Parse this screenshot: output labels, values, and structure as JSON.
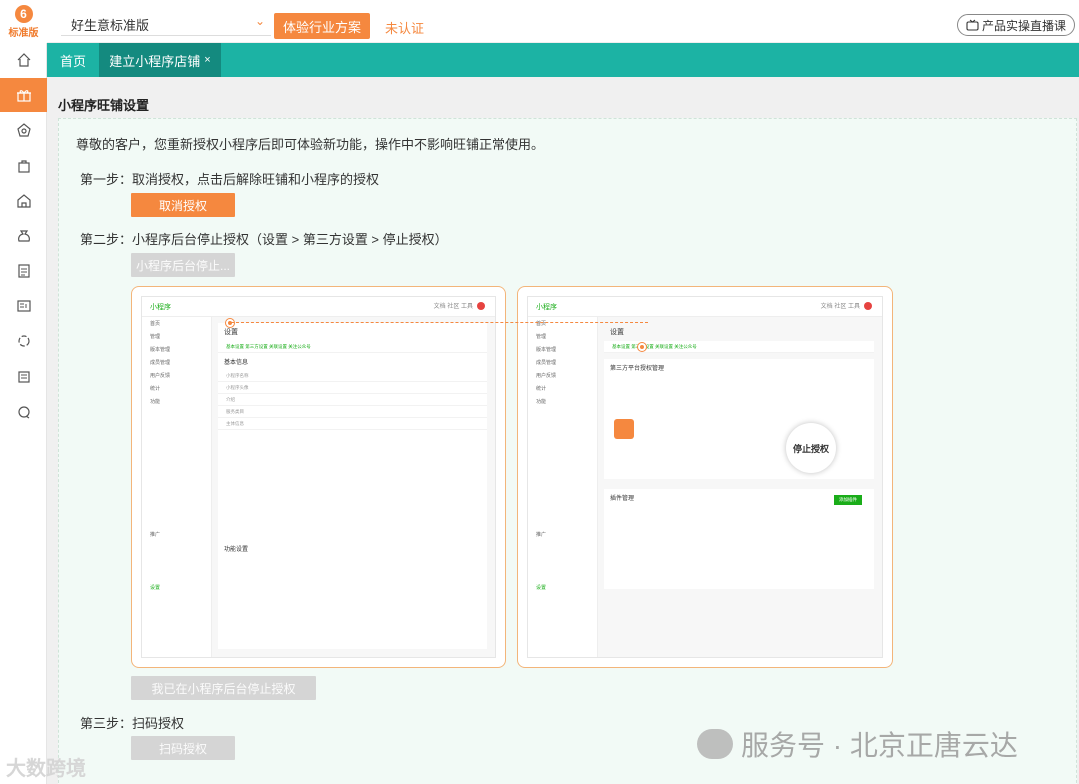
{
  "app": {
    "logo_text": "标准版",
    "store_name": "好生意标准版",
    "solution_button": "体验行业方案",
    "certification_status": "未认证",
    "live_button": "产品实操直播课"
  },
  "sidebar": {
    "items": [
      {
        "icon": "home-icon"
      },
      {
        "icon": "gift-icon"
      },
      {
        "icon": "store-icon"
      },
      {
        "icon": "bag-icon"
      },
      {
        "icon": "shop-icon"
      },
      {
        "icon": "money-bag-icon"
      },
      {
        "icon": "document-icon"
      },
      {
        "icon": "report-icon"
      },
      {
        "icon": "cycle-icon"
      },
      {
        "icon": "news-icon"
      },
      {
        "icon": "chat-icon"
      }
    ],
    "active_index": 1
  },
  "tabs": {
    "home": "首页",
    "active": "建立小程序店铺",
    "close": "×"
  },
  "page": {
    "title": "小程序旺铺设置",
    "notice": "尊敬的客户，您重新授权小程序后即可体验新功能，操作中不影响旺铺正常使用。",
    "step1": "第一步：取消授权，点击后解除旺铺和小程序的授权",
    "step1_button": "取消授权",
    "step2": "第二步：小程序后台停止授权（设置 > 第三方设置 > 停止授权）",
    "step2_button": "小程序后台停止...",
    "confirm_button": "我已在小程序后台停止授权",
    "step3": "第三步：扫码授权",
    "step3_button": "扫码授权"
  },
  "screenshots": {
    "left": {
      "app_name": "小程序",
      "header_right": "文档  社区  工具",
      "page_title": "设置",
      "tabs": "基本设置   第三方设置   关联设置   关注公众号",
      "section": "基本信息",
      "sidebar_items": [
        "首页",
        "管理",
        "版本管理",
        "成员管理",
        "用户反馈",
        "统计",
        "功能",
        "推广",
        "设置"
      ],
      "rows": [
        "小程序名称",
        "小程序头像",
        "介绍",
        "服务类目",
        "主体信息"
      ],
      "section2": "功能设置"
    },
    "right": {
      "app_name": "小程序",
      "header_right": "文档  社区  工具",
      "page_title": "设置",
      "tabs": "基本设置   第三方设置   关联设置   关注公众号",
      "section": "第三方平台授权管理",
      "stop_label": "停止授权",
      "plugin_section": "插件管理",
      "plugin_button": "添加插件",
      "sidebar_items": [
        "首页",
        "管理",
        "版本管理",
        "成员管理",
        "用户反馈",
        "统计",
        "功能",
        "推广",
        "设置"
      ]
    }
  },
  "watermarks": {
    "right": "服务号 · 北京正唐云达",
    "left": "大数跨境"
  },
  "colors": {
    "accent": "#f5883f",
    "teal": "#1cb3a4",
    "teal_dark": "#148a7f",
    "wechat_green": "#1aad19"
  }
}
